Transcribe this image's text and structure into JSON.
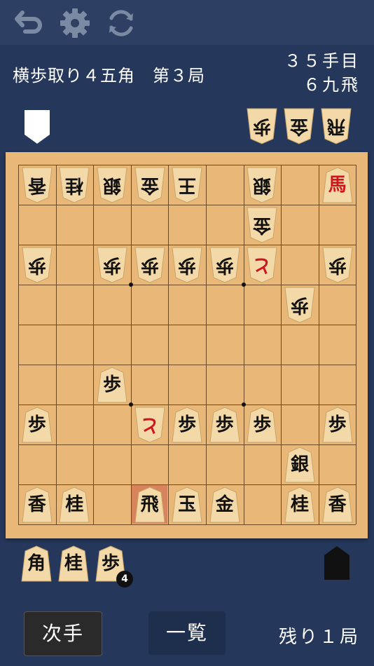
{
  "toolbar": {
    "undo_icon": "undo-icon",
    "settings_icon": "gear-icon",
    "reload_icon": "refresh-icon",
    "icon_color": "#7b8aa3"
  },
  "header": {
    "title": "横歩取り４五角　第３局",
    "move_number": "３５手目",
    "last_move": "６九飛"
  },
  "colors": {
    "background": "#25375a",
    "board": "#e9b878",
    "piece": "#f3d9a8",
    "promoted_text": "#d1141b"
  },
  "opponent_hand": [
    {
      "char": "歩",
      "count": ""
    },
    {
      "char": "金",
      "count": ""
    },
    {
      "char": "飛",
      "count": ""
    }
  ],
  "player_hand": [
    {
      "char": "角",
      "count": ""
    },
    {
      "char": "桂",
      "count": ""
    },
    {
      "char": "歩",
      "count": "4"
    }
  ],
  "board": {
    "pieces": [
      {
        "char": "香",
        "file": 9,
        "rank": 1,
        "owner": "opponent"
      },
      {
        "char": "桂",
        "file": 8,
        "rank": 1,
        "owner": "opponent"
      },
      {
        "char": "銀",
        "file": 7,
        "rank": 1,
        "owner": "opponent"
      },
      {
        "char": "金",
        "file": 6,
        "rank": 1,
        "owner": "opponent"
      },
      {
        "char": "王",
        "file": 5,
        "rank": 1,
        "owner": "opponent"
      },
      {
        "char": "銀",
        "file": 3,
        "rank": 1,
        "owner": "opponent"
      },
      {
        "char": "馬",
        "file": 1,
        "rank": 1,
        "owner": "player",
        "promoted": true
      },
      {
        "char": "金",
        "file": 3,
        "rank": 2,
        "owner": "opponent"
      },
      {
        "char": "歩",
        "file": 9,
        "rank": 3,
        "owner": "opponent"
      },
      {
        "char": "歩",
        "file": 7,
        "rank": 3,
        "owner": "opponent"
      },
      {
        "char": "歩",
        "file": 6,
        "rank": 3,
        "owner": "opponent"
      },
      {
        "char": "歩",
        "file": 5,
        "rank": 3,
        "owner": "opponent"
      },
      {
        "char": "歩",
        "file": 4,
        "rank": 3,
        "owner": "opponent"
      },
      {
        "char": "と",
        "file": 3,
        "rank": 3,
        "owner": "opponent",
        "promoted": true
      },
      {
        "char": "歩",
        "file": 1,
        "rank": 3,
        "owner": "opponent"
      },
      {
        "char": "歩",
        "file": 2,
        "rank": 4,
        "owner": "opponent"
      },
      {
        "char": "歩",
        "file": 7,
        "rank": 6,
        "owner": "player"
      },
      {
        "char": "歩",
        "file": 9,
        "rank": 7,
        "owner": "player"
      },
      {
        "char": "と",
        "file": 6,
        "rank": 7,
        "owner": "opponent",
        "promoted": true
      },
      {
        "char": "歩",
        "file": 5,
        "rank": 7,
        "owner": "player"
      },
      {
        "char": "歩",
        "file": 4,
        "rank": 7,
        "owner": "player"
      },
      {
        "char": "歩",
        "file": 3,
        "rank": 7,
        "owner": "player"
      },
      {
        "char": "歩",
        "file": 1,
        "rank": 7,
        "owner": "player"
      },
      {
        "char": "銀",
        "file": 2,
        "rank": 8,
        "owner": "player"
      },
      {
        "char": "香",
        "file": 9,
        "rank": 9,
        "owner": "player"
      },
      {
        "char": "桂",
        "file": 8,
        "rank": 9,
        "owner": "player"
      },
      {
        "char": "飛",
        "file": 6,
        "rank": 9,
        "owner": "player"
      },
      {
        "char": "玉",
        "file": 5,
        "rank": 9,
        "owner": "player"
      },
      {
        "char": "金",
        "file": 4,
        "rank": 9,
        "owner": "player"
      },
      {
        "char": "桂",
        "file": 2,
        "rank": 9,
        "owner": "player"
      },
      {
        "char": "香",
        "file": 1,
        "rank": 9,
        "owner": "player"
      }
    ],
    "last_move": {
      "file": 6,
      "rank": 9
    }
  },
  "footer": {
    "next_label": "次手",
    "list_label": "一覧",
    "remaining": "残り１局"
  }
}
